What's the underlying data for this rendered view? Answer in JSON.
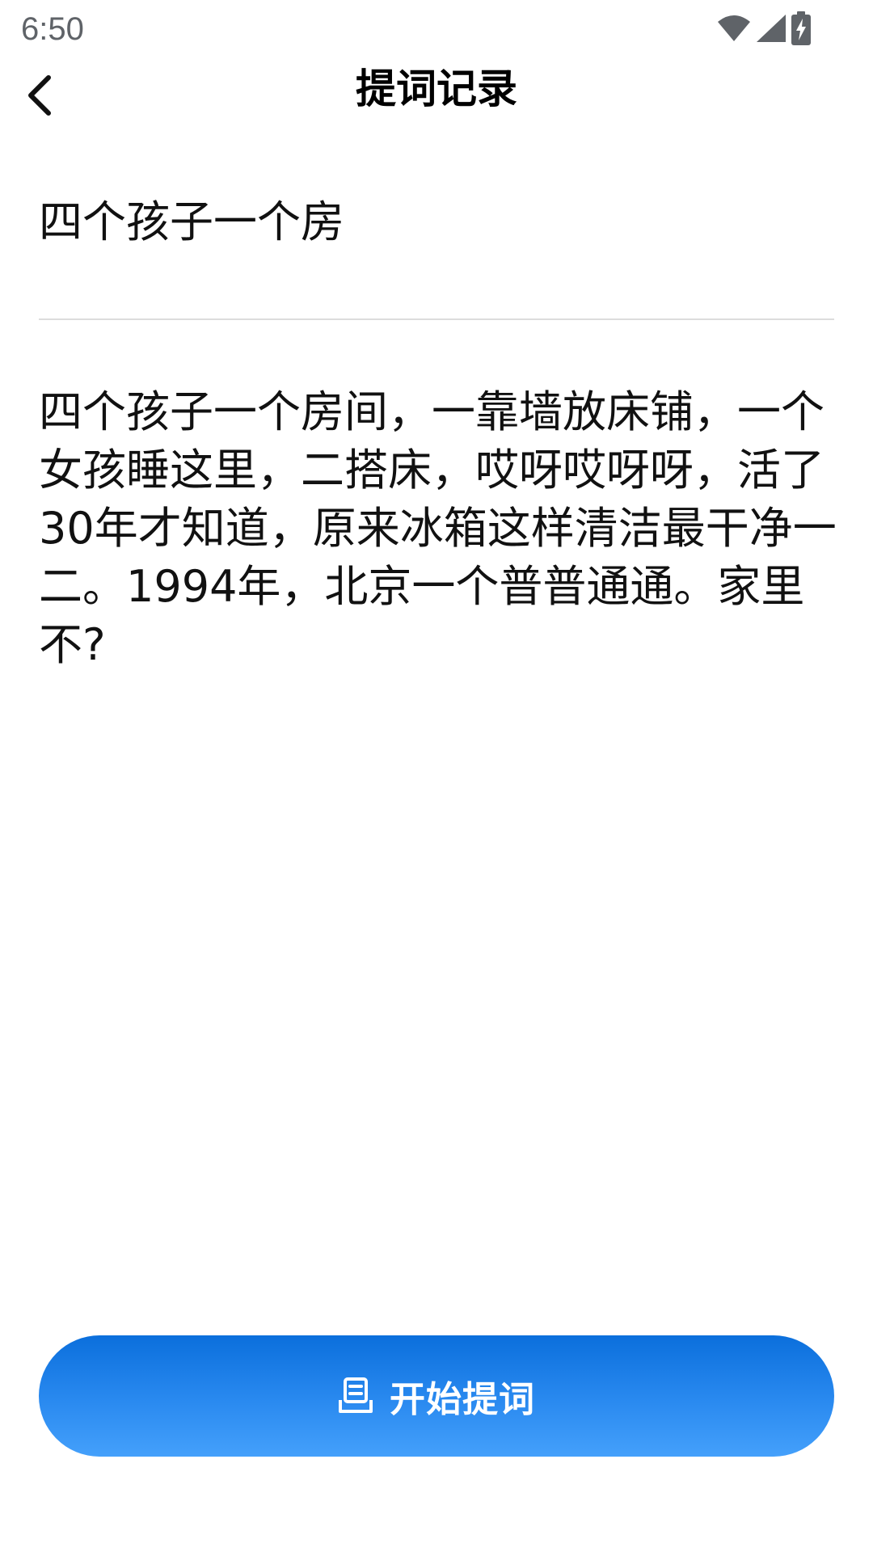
{
  "status_bar": {
    "time": "6:50",
    "icons": [
      "wifi-icon",
      "cell-signal-icon",
      "battery-charging-icon"
    ]
  },
  "header": {
    "title": "提词记录",
    "back_icon": "chevron-left-icon"
  },
  "record": {
    "title": "四个孩子一个房",
    "content": "四个孩子一个房间，一靠墙放床铺，一个女孩睡这里，二搭床，哎呀哎呀呀，活了30年才知道，原来冰箱这样清洁最干净一二。1994年，北京一个普普通通。家里不?"
  },
  "start_button": {
    "label": "开始提词",
    "icon": "teleprompter-icon"
  },
  "colors": {
    "accent": "#2a8af0",
    "accent_dark": "#0b6fdc",
    "text": "#111111",
    "divider": "#dcdcdc",
    "status_gray": "#5f6368"
  }
}
